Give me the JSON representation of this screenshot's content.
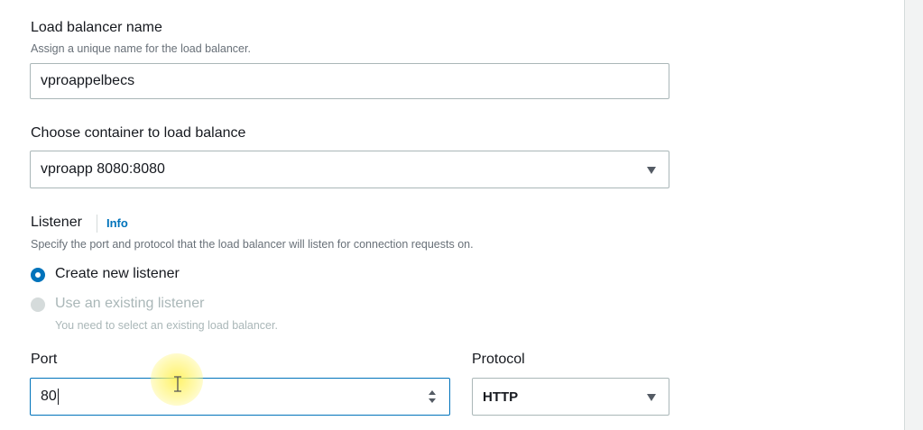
{
  "load_balancer": {
    "label": "Load balancer name",
    "description": "Assign a unique name for the load balancer.",
    "value": "vproappelbecs"
  },
  "container": {
    "label": "Choose container to load balance",
    "selected": "vproapp 8080:8080"
  },
  "listener": {
    "label": "Listener",
    "info": "Info",
    "description": "Specify the port and protocol that the load balancer will listen for connection requests on.",
    "options": [
      {
        "label": "Create new listener",
        "checked": true,
        "disabled": false
      },
      {
        "label": "Use an existing listener",
        "checked": false,
        "disabled": true,
        "hint": "You need to select an existing load balancer."
      }
    ]
  },
  "port": {
    "label": "Port",
    "value": "80"
  },
  "protocol": {
    "label": "Protocol",
    "selected": "HTTP"
  },
  "colors": {
    "accent": "#0073bb",
    "text": "#16191f",
    "muted": "#687078",
    "disabled": "#aab7b8"
  }
}
